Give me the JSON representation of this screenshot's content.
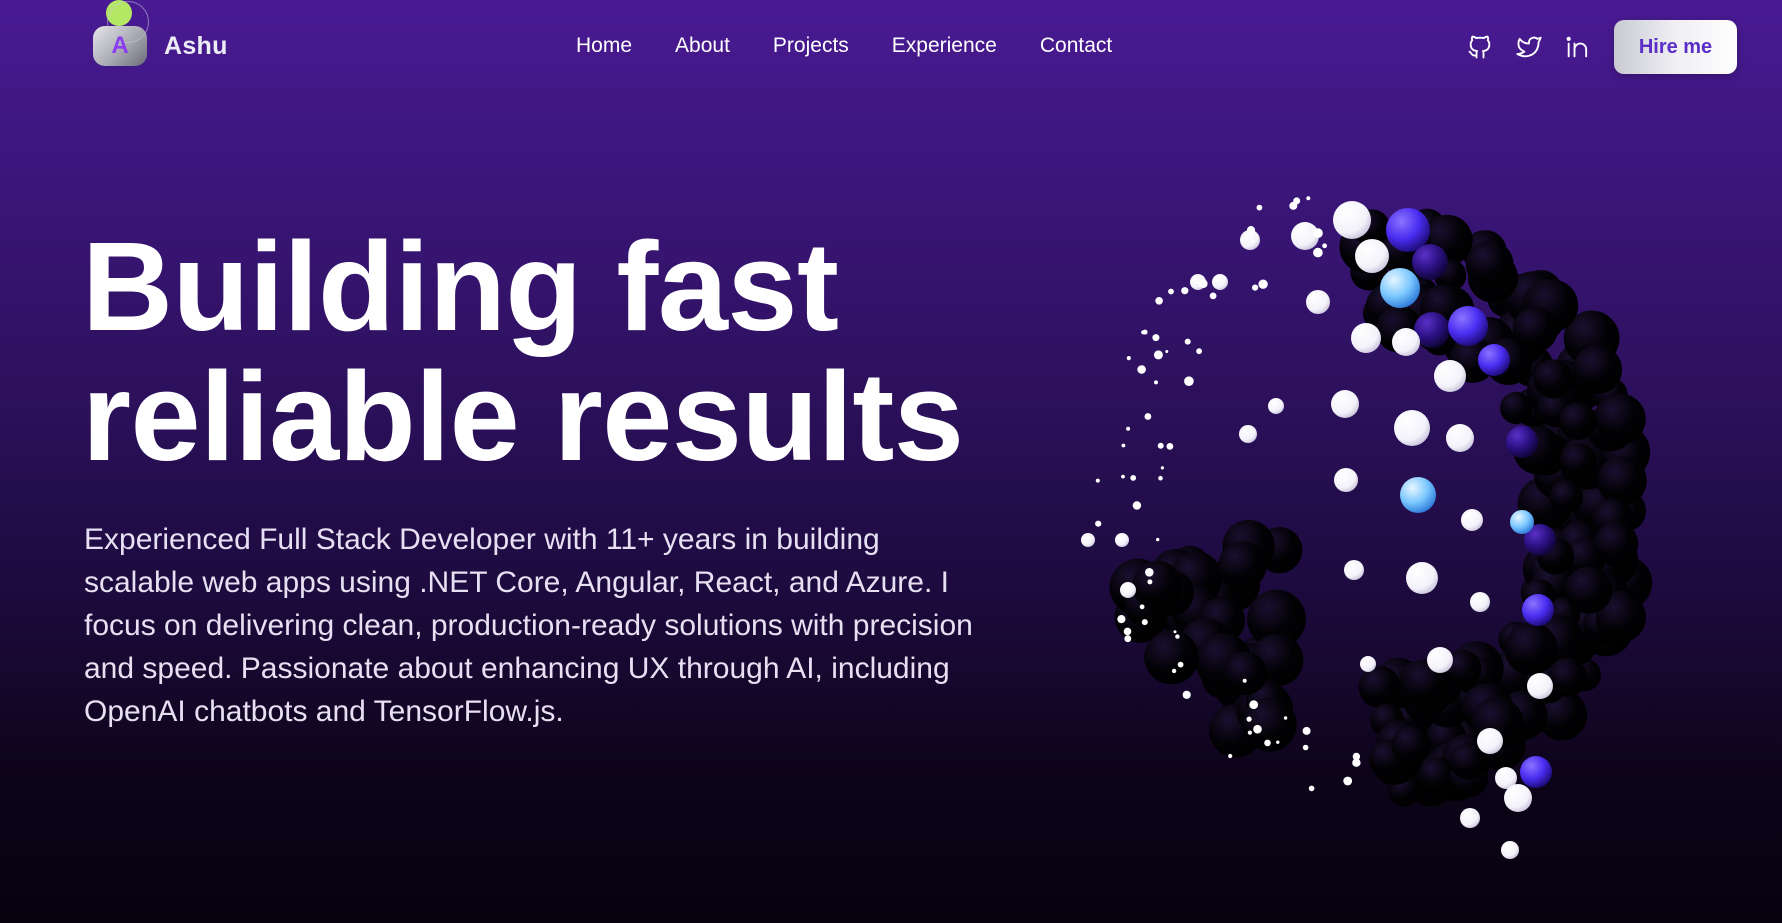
{
  "brand": {
    "initial": "A",
    "name": "Ashu"
  },
  "nav": {
    "links": [
      "Home",
      "About",
      "Projects",
      "Experience",
      "Contact"
    ]
  },
  "social": {
    "icons": [
      "github-icon",
      "twitter-icon",
      "linkedin-icon"
    ]
  },
  "cta": {
    "hire_label": "Hire me"
  },
  "hero": {
    "title_line1": "Building fast",
    "title_line2": "reliable results",
    "description": "Experienced Full Stack Developer with 11+ years in building scalable web apps using .NET Core, Angular, React, and Azure. I focus on delivering clean, production-ready solutions with precision and speed. Passionate about enhancing UX through AI, including OpenAI chatbots and TensorFlow.js."
  },
  "colors": {
    "background_top": "#4a1a94",
    "background_bottom": "#060210",
    "accent": "#5a2ec6",
    "brand_dot": "#b4e864",
    "particle_blue": "#4a2cf0",
    "particle_cyan": "#7cc8ff"
  }
}
